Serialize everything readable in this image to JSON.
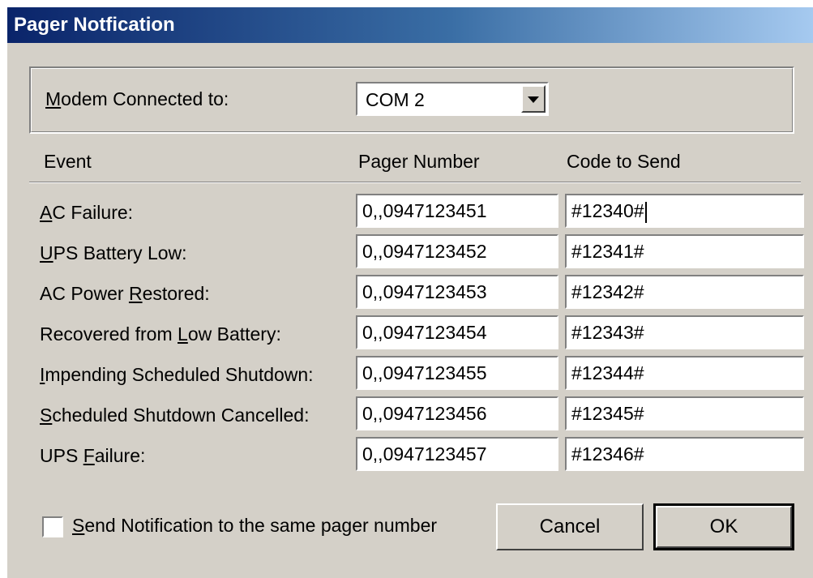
{
  "window": {
    "title": "Pager Notfication"
  },
  "modem": {
    "label_accel": "M",
    "label_rest": "odem Connected to:",
    "selected": "COM 2"
  },
  "headers": {
    "event": "Event",
    "pager_number": "Pager Number",
    "code_to_send": "Code to Send"
  },
  "rows": [
    {
      "pre": "",
      "accel": "A",
      "post": "C Failure:",
      "pager": "0,,0947123451",
      "code": "#12340#"
    },
    {
      "pre": "",
      "accel": "U",
      "post": "PS Battery Low:",
      "pager": "0,,0947123452",
      "code": "#12341#"
    },
    {
      "pre": "AC Power ",
      "accel": "R",
      "post": "estored:",
      "pager": "0,,0947123453",
      "code": "#12342#"
    },
    {
      "pre": "Recovered from ",
      "accel": "L",
      "post": "ow Battery:",
      "pager": "0,,0947123454",
      "code": "#12343#"
    },
    {
      "pre": "",
      "accel": "I",
      "post": "mpending Scheduled Shutdown:",
      "pager": "0,,0947123455",
      "code": "#12344#"
    },
    {
      "pre": "",
      "accel": "S",
      "post": "cheduled Shutdown Cancelled:",
      "pager": "0,,0947123456",
      "code": "#12345#"
    },
    {
      "pre": "UPS ",
      "accel": "F",
      "post": "ailure:",
      "pager": "0,,0947123457",
      "code": "#12346#"
    }
  ],
  "same_pager": {
    "checked": false,
    "label_accel": "S",
    "label_rest": "end Notification to the same pager number"
  },
  "buttons": {
    "cancel": "Cancel",
    "ok": "OK"
  },
  "colors": {
    "face": "#d4d0c8",
    "title_start": "#0a246a",
    "title_end": "#a6caf0"
  }
}
